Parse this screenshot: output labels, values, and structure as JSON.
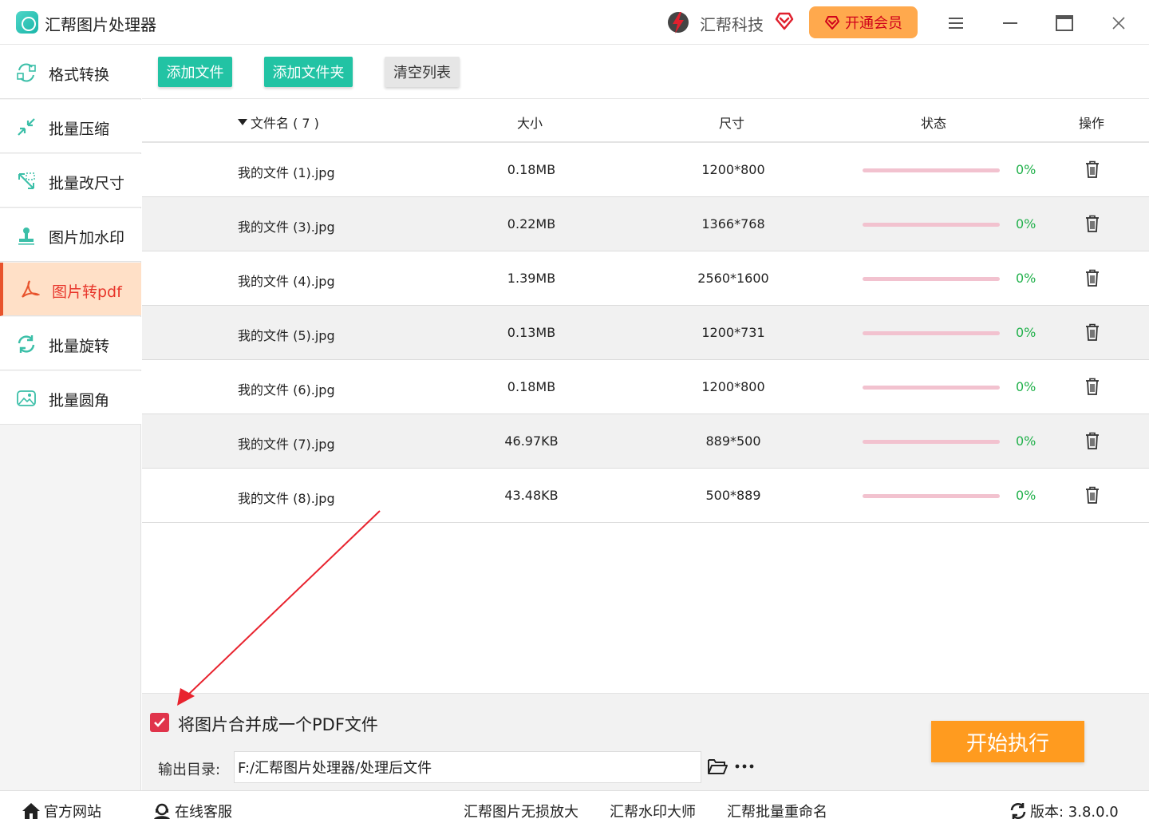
{
  "window": {
    "title": "汇帮图片处理器",
    "brand": "汇帮科技",
    "vip_label": "开通会员",
    "accent_color": "#22c3a4",
    "active_color": "#e8352a"
  },
  "sidebar": {
    "items": [
      {
        "label": "格式转换",
        "icon": "format-convert-icon"
      },
      {
        "label": "批量压缩",
        "icon": "compress-icon"
      },
      {
        "label": "批量改尺寸",
        "icon": "resize-icon"
      },
      {
        "label": "图片加水印",
        "icon": "watermark-icon"
      },
      {
        "label": "图片转pdf",
        "icon": "pdf-icon",
        "active": true
      },
      {
        "label": "批量旋转",
        "icon": "rotate-icon"
      },
      {
        "label": "批量圆角",
        "icon": "round-corner-icon"
      }
    ]
  },
  "toolbar": {
    "add_file": "添加文件",
    "add_folder": "添加文件夹",
    "clear_list": "清空列表"
  },
  "table": {
    "headers": {
      "name": "文件名 ( 7 )",
      "size": "大小",
      "dimension": "尺寸",
      "status": "状态",
      "action": "操作"
    },
    "rows": [
      {
        "name": "我的文件 (1).jpg",
        "size": "0.18MB",
        "dimension": "1200*800",
        "progress": 0,
        "status": "0%"
      },
      {
        "name": "我的文件 (3).jpg",
        "size": "0.22MB",
        "dimension": "1366*768",
        "progress": 0,
        "status": "0%"
      },
      {
        "name": "我的文件 (4).jpg",
        "size": "1.39MB",
        "dimension": "2560*1600",
        "progress": 0,
        "status": "0%"
      },
      {
        "name": "我的文件 (5).jpg",
        "size": "0.13MB",
        "dimension": "1200*731",
        "progress": 0,
        "status": "0%"
      },
      {
        "name": "我的文件 (6).jpg",
        "size": "0.18MB",
        "dimension": "1200*800",
        "progress": 0,
        "status": "0%"
      },
      {
        "name": "我的文件 (7).jpg",
        "size": "46.97KB",
        "dimension": "889*500",
        "progress": 0,
        "status": "0%"
      },
      {
        "name": "我的文件 (8).jpg",
        "size": "43.48KB",
        "dimension": "500*889",
        "progress": 0,
        "status": "0%"
      }
    ]
  },
  "options": {
    "merge_label": "将图片合并成一个PDF文件",
    "merge_checked": true,
    "output_label": "输出目录:",
    "output_path": "F:/汇帮图片处理器/处理后文件",
    "start_label": "开始执行"
  },
  "footer": {
    "website": "官方网站",
    "support": "在线客服",
    "links": [
      "汇帮图片无损放大",
      "汇帮水印大师",
      "汇帮批量重命名"
    ],
    "version": "版本:  3.8.0.0"
  }
}
